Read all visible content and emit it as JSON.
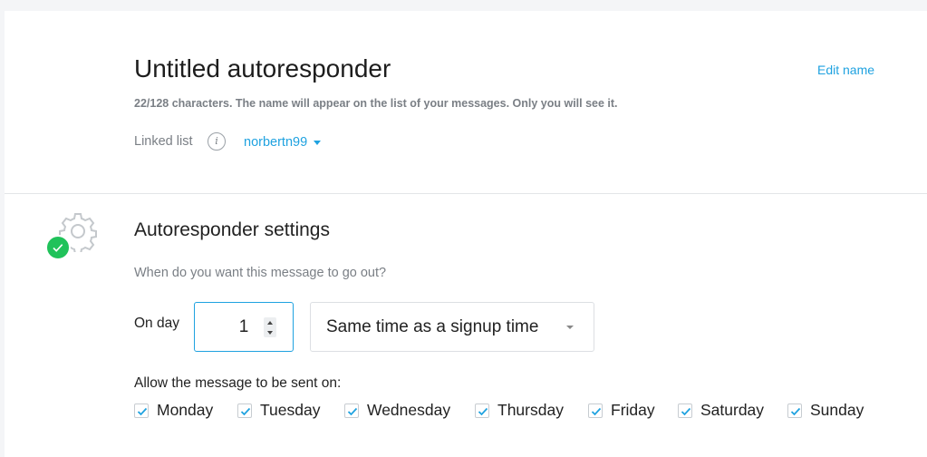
{
  "message": {
    "title": "Untitled autoresponder",
    "edit_label": "Edit name",
    "hint": "22/128 characters. The name will appear on the list of your messages. Only you will see it.",
    "linked_list_label": "Linked list",
    "info_glyph": "i",
    "linked_list_value": "norbertn99"
  },
  "settings": {
    "title": "Autoresponder settings",
    "question": "When do you want this message to go out?",
    "on_day_label": "On day",
    "day_value": "1",
    "time_option": "Same time as a signup time",
    "allow_label": "Allow the message to be sent on:",
    "days": [
      {
        "label": "Monday",
        "checked": true
      },
      {
        "label": "Tuesday",
        "checked": true
      },
      {
        "label": "Wednesday",
        "checked": true
      },
      {
        "label": "Thursday",
        "checked": true
      },
      {
        "label": "Friday",
        "checked": true
      },
      {
        "label": "Saturday",
        "checked": true
      },
      {
        "label": "Sunday",
        "checked": true
      }
    ]
  },
  "colors": {
    "accent": "#1fa2e0",
    "success": "#20c25a",
    "muted_text": "#7a7f85"
  },
  "icons": {
    "settings": "gear-icon",
    "status": "check-badge-icon",
    "info": "info-icon",
    "dropdown": "chevron-down-icon"
  }
}
